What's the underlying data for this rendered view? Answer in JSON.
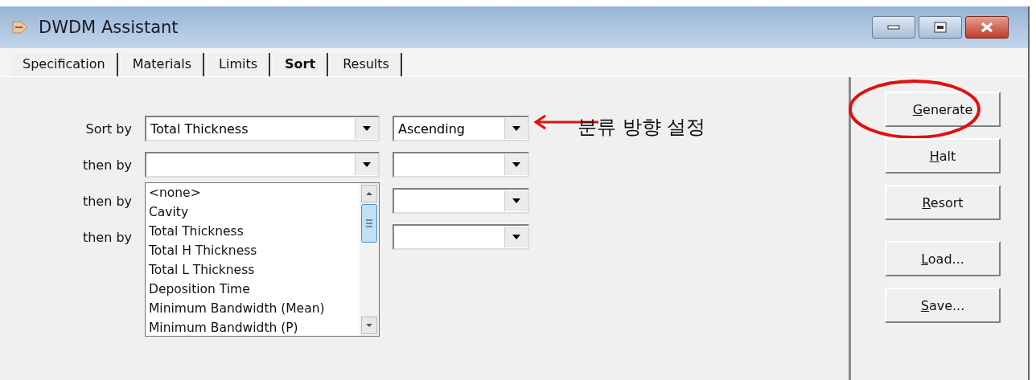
{
  "window": {
    "title": "DWDM Assistant"
  },
  "tabs": [
    {
      "label": "Specification",
      "selected": false
    },
    {
      "label": "Materials",
      "selected": false
    },
    {
      "label": "Limits",
      "selected": false
    },
    {
      "label": "Sort",
      "selected": true
    },
    {
      "label": "Results",
      "selected": false
    }
  ],
  "sort_rows": [
    {
      "label": "Sort by",
      "field": "Total Thickness",
      "order": "Ascending"
    },
    {
      "label": "then by",
      "open_list": [
        "<none>",
        "Cavity",
        "Total Thickness",
        "Total H Thickness",
        "Total L Thickness",
        "Deposition Time",
        "Minimum Bandwidth (Mean)",
        "Minimum Bandwidth (P)"
      ]
    },
    {
      "label": "then by"
    },
    {
      "label": "then by"
    }
  ],
  "buttons": [
    {
      "label": "Generate",
      "circled": true
    },
    {
      "label": "Halt",
      "circled": false
    },
    {
      "label": "Resort",
      "circled": false
    },
    {
      "label": "Load...",
      "circled": false
    },
    {
      "label": "Save...",
      "circled": false
    }
  ],
  "annotation": {
    "text": "분류 방향 설정"
  }
}
